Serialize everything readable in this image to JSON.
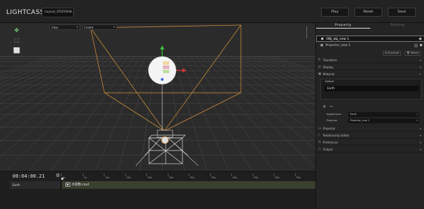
{
  "app": {
    "logo": "LIGHTCASSO",
    "layout_value": "Layout_0505063...",
    "buttons": {
      "play": "Play",
      "reset": "Reset",
      "save": "Save"
    }
  },
  "viewport": {
    "view_dropdown": "View",
    "create_dropdown": "Create",
    "tools": [
      "move-icon",
      "transform-icon",
      "frame-icon"
    ]
  },
  "timeline": {
    "timecode": "00:04:00.21",
    "ticks": [
      "0s",
      "5s",
      "10s",
      "15s",
      "20s",
      "25s",
      "30s",
      "35s",
      "40s",
      "45s",
      "50s",
      "55s"
    ],
    "track_label": "Earth",
    "clip_name": "水夜数.mp4"
  },
  "panel": {
    "tabs": [
      "Property",
      "Setting"
    ],
    "objects": [
      {
        "name": "OBJ_obj_new 1",
        "selected": true
      },
      {
        "name": "Projector_new 1",
        "selected": false
      }
    ],
    "duplicate_label": "Duplicate",
    "delete_label": "Delete",
    "sections_top": [
      "Transform",
      "Display",
      "Material"
    ],
    "material": {
      "group_label": "Default",
      "item": "Earth",
      "appearance_label": "Appearance",
      "appearance_value": "Earth",
      "projector_label": "Projector",
      "projector_value": "Projector_new 1"
    },
    "sections_bottom": [
      "Projector",
      "Relationship Editor",
      "Preference",
      "Output"
    ]
  },
  "colors": {
    "accent_orange": "#c98a3a",
    "grid": "#4a4a4a",
    "axis_green": "#3fc23f",
    "axis_red": "#d93333",
    "axis_blue": "#3d6fe0"
  }
}
